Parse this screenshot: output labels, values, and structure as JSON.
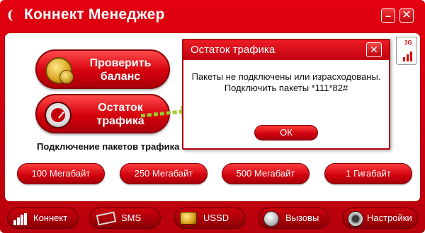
{
  "window": {
    "title": "Коннект Менеджер",
    "logo_glyph": "(",
    "minimize_glyph": "–",
    "close_glyph": "✕"
  },
  "main": {
    "check_balance_label": "Проверить баланс",
    "traffic_remaining_label": "Остаток трафика",
    "packages_heading": "Подключение пакетов трафика",
    "packages": [
      {
        "label": "100 Мегабайт"
      },
      {
        "label": "250 Мегабайт"
      },
      {
        "label": "500 Мегабайт"
      },
      {
        "label": "1 Гигабайт"
      }
    ],
    "signal_tab_label": "3G"
  },
  "dialog": {
    "title": "Остаток трафика",
    "message": "Пакеты не подключены или израсходованы. Подключить пакеты *111*82#",
    "ok_label": "ОК",
    "close_glyph": "✕"
  },
  "tabs": [
    {
      "label": "Коннект",
      "icon": "signal-bars-icon"
    },
    {
      "label": "SMS",
      "icon": "envelope-icon"
    },
    {
      "label": "USSD",
      "icon": "coins-icon"
    },
    {
      "label": "Вызовы",
      "icon": "phone-icon"
    },
    {
      "label": "Настройки",
      "icon": "gear-icon"
    }
  ],
  "colors": {
    "brand_red": "#e3000f",
    "dark_red": "#8a0006",
    "arrow_green": "#9ccc2a"
  }
}
